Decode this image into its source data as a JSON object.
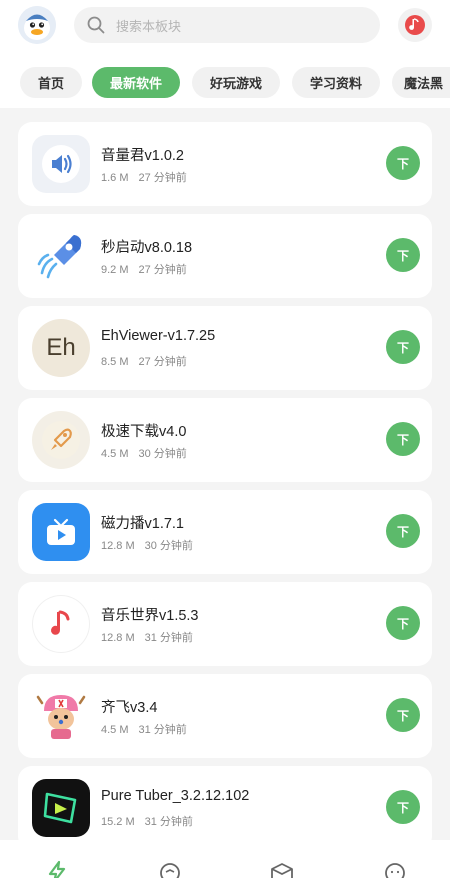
{
  "header": {
    "search_placeholder": "搜索本板块"
  },
  "tabs": [
    {
      "label": "首页",
      "active": false
    },
    {
      "label": "最新软件",
      "active": true
    },
    {
      "label": "好玩游戏",
      "active": false
    },
    {
      "label": "学习资料",
      "active": false
    },
    {
      "label": "魔法黑",
      "active": false
    }
  ],
  "apps": [
    {
      "name": "音量君v1.0.2",
      "size": "1.6 M",
      "time": "27 分钟前",
      "icon": "volume-icon",
      "download_label": "下"
    },
    {
      "name": "秒启动v8.0.18",
      "size": "9.2 M",
      "time": "27 分钟前",
      "icon": "rocket-icon",
      "download_label": "下"
    },
    {
      "name": "EhViewer-v1.7.25",
      "size": "8.5 M",
      "time": "27 分钟前",
      "icon": "eh-icon",
      "icon_text": "Eh",
      "download_label": "下"
    },
    {
      "name": "极速下载v4.0",
      "size": "4.5 M",
      "time": "30 分钟前",
      "icon": "rocket-badge-icon",
      "download_label": "下"
    },
    {
      "name": "磁力播v1.7.1",
      "size": "12.8 M",
      "time": "30 分钟前",
      "icon": "tv-play-icon",
      "download_label": "下"
    },
    {
      "name": "音乐世界v1.5.3",
      "size": "12.8 M",
      "time": "31 分钟前",
      "icon": "music-note-icon",
      "download_label": "下"
    },
    {
      "name": "齐飞v3.4",
      "size": "4.5 M",
      "time": "31 分钟前",
      "icon": "chopper-icon",
      "download_label": "下"
    },
    {
      "name": "Pure Tuber_3.2.12.102",
      "size": "15.2 M",
      "time": "31 分钟前",
      "icon": "pure-tuber-icon",
      "download_label": "下"
    }
  ],
  "colors": {
    "accent": "#5cba6b",
    "background": "#f4f4f4",
    "card": "#ffffff"
  }
}
